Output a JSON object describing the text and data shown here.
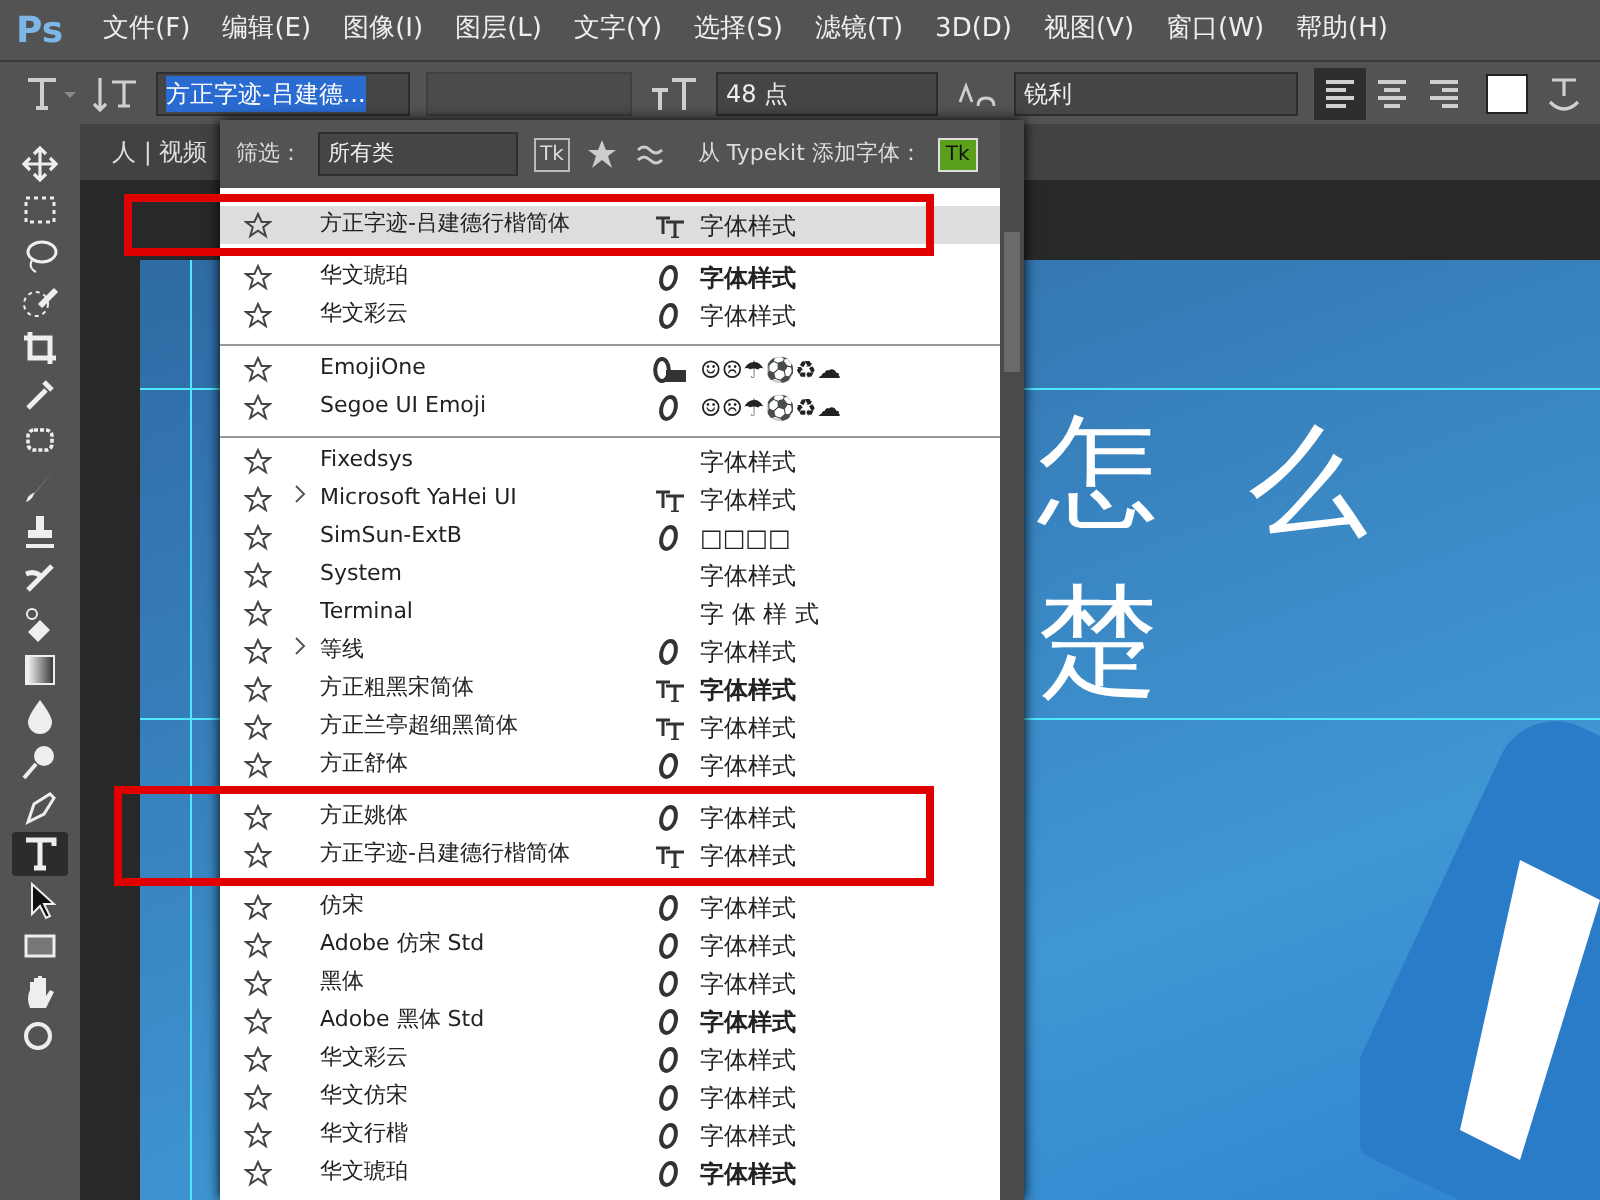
{
  "app": {
    "logo": "Ps"
  },
  "menu": [
    "文件(F)",
    "编辑(E)",
    "图像(I)",
    "图层(L)",
    "文字(Y)",
    "选择(S)",
    "滤镜(T)",
    "3D(D)",
    "视图(V)",
    "窗口(W)",
    "帮助(H)"
  ],
  "options_bar": {
    "font_family": {
      "value": "方正字迹-吕建德...",
      "selected": true
    },
    "font_size": "48 点",
    "antialias": "锐利",
    "align": [
      {
        "selected": true
      },
      {
        "selected": false
      },
      {
        "selected": false
      }
    ]
  },
  "tools": [
    {
      "selected": false
    },
    {
      "selected": false
    },
    {
      "selected": false
    },
    {
      "selected": false
    },
    {
      "selected": false
    },
    {
      "selected": false
    },
    {
      "selected": false
    },
    {
      "selected": false
    },
    {
      "selected": false
    },
    {
      "selected": false
    },
    {
      "selected": false
    },
    {
      "selected": false
    },
    {
      "selected": false
    },
    {
      "selected": false
    },
    {
      "selected": false
    },
    {
      "selected": true
    },
    {
      "selected": false
    },
    {
      "selected": false
    },
    {
      "selected": false
    },
    {
      "selected": false
    }
  ],
  "doc_tab": "人 | 视频",
  "font_menu": {
    "filter_label": "筛选：",
    "filter_value": "所有类",
    "filter_typekit": "Tk",
    "typekit_label": "从 Typekit 添加字体：",
    "typekit_badge": "Tk",
    "sections": [
      {
        "fonts": [
          {
            "name": "方正字迹-吕建德行楷简体",
            "kind": "tt",
            "preview": "字体样式",
            "expandable": false,
            "selected": true,
            "marked": true
          },
          {
            "name": "华文琥珀",
            "kind": "o",
            "preview": "字体样式",
            "bold": true,
            "expandable": false,
            "selected": false,
            "marked": false
          },
          {
            "name": "华文彩云",
            "kind": "o",
            "preview": "字体样式",
            "expandable": false,
            "selected": false,
            "marked": false
          }
        ]
      },
      {
        "fonts": [
          {
            "name": "EmojiOne",
            "kind": "svg",
            "preview": "☺☹☂⚽♻☁",
            "expandable": false,
            "selected": false,
            "marked": false
          },
          {
            "name": "Segoe UI Emoji",
            "kind": "o",
            "preview": "☺☹☂⚽♻☁",
            "expandable": false,
            "selected": false,
            "marked": false
          }
        ]
      },
      {
        "fonts": [
          {
            "name": "Fixedsys",
            "kind": "none",
            "preview": "字体样式",
            "expandable": false,
            "selected": false,
            "marked": false
          },
          {
            "name": "Microsoft YaHei UI",
            "kind": "tt",
            "preview": "字体样式",
            "expandable": true,
            "selected": false,
            "marked": false
          },
          {
            "name": "SimSun-ExtB",
            "kind": "o",
            "preview": "□□□□",
            "expandable": false,
            "selected": false,
            "marked": false
          },
          {
            "name": "System",
            "kind": "none",
            "preview": "字体样式",
            "expandable": false,
            "selected": false,
            "marked": false
          },
          {
            "name": "Terminal",
            "kind": "none",
            "preview": "字 体 样 式",
            "expandable": false,
            "selected": false,
            "marked": false
          },
          {
            "name": "等线",
            "kind": "o",
            "preview": "字体样式",
            "expandable": true,
            "selected": false,
            "marked": false
          },
          {
            "name": "方正粗黑宋简体",
            "kind": "tt",
            "preview": "字体样式",
            "bold": true,
            "expandable": false,
            "selected": false,
            "marked": false
          },
          {
            "name": "方正兰亭超细黑简体",
            "kind": "tt",
            "preview": "字体样式",
            "expandable": false,
            "selected": false,
            "marked": false
          },
          {
            "name": "方正舒体",
            "kind": "o",
            "preview": "字体样式",
            "expandable": false,
            "selected": false,
            "marked": false
          },
          {
            "name": "方正姚体",
            "kind": "o",
            "preview": "字体样式",
            "expandable": false,
            "selected": false,
            "marked": true
          },
          {
            "name": "方正字迹-吕建德行楷简体",
            "kind": "tt",
            "preview": "字体样式",
            "expandable": false,
            "selected": false,
            "marked": true
          },
          {
            "name": "仿宋",
            "kind": "o",
            "preview": "字体样式",
            "expandable": false,
            "selected": false,
            "marked": false
          },
          {
            "name": "Adobe 仿宋 Std",
            "kind": "o",
            "preview": "字体样式",
            "expandable": false,
            "selected": false,
            "marked": false
          },
          {
            "name": "黑体",
            "kind": "o",
            "preview": "字体样式",
            "expandable": false,
            "selected": false,
            "marked": false
          },
          {
            "name": "Adobe 黑体 Std",
            "kind": "o",
            "preview": "字体样式",
            "bold": true,
            "expandable": false,
            "selected": false,
            "marked": false
          },
          {
            "name": "华文彩云",
            "kind": "o",
            "preview": "字体样式",
            "expandable": false,
            "selected": false,
            "marked": false
          },
          {
            "name": "华文仿宋",
            "kind": "o",
            "preview": "字体样式",
            "expandable": false,
            "selected": false,
            "marked": false
          },
          {
            "name": "华文行楷",
            "kind": "o",
            "preview": "字体样式",
            "expandable": false,
            "selected": false,
            "marked": false
          },
          {
            "name": "华文琥珀",
            "kind": "o",
            "preview": "字体样式",
            "bold": true,
            "expandable": false,
            "selected": false,
            "marked": false
          }
        ]
      }
    ]
  },
  "canvas": {
    "texts": [
      "怎",
      "么",
      "楚"
    ]
  }
}
